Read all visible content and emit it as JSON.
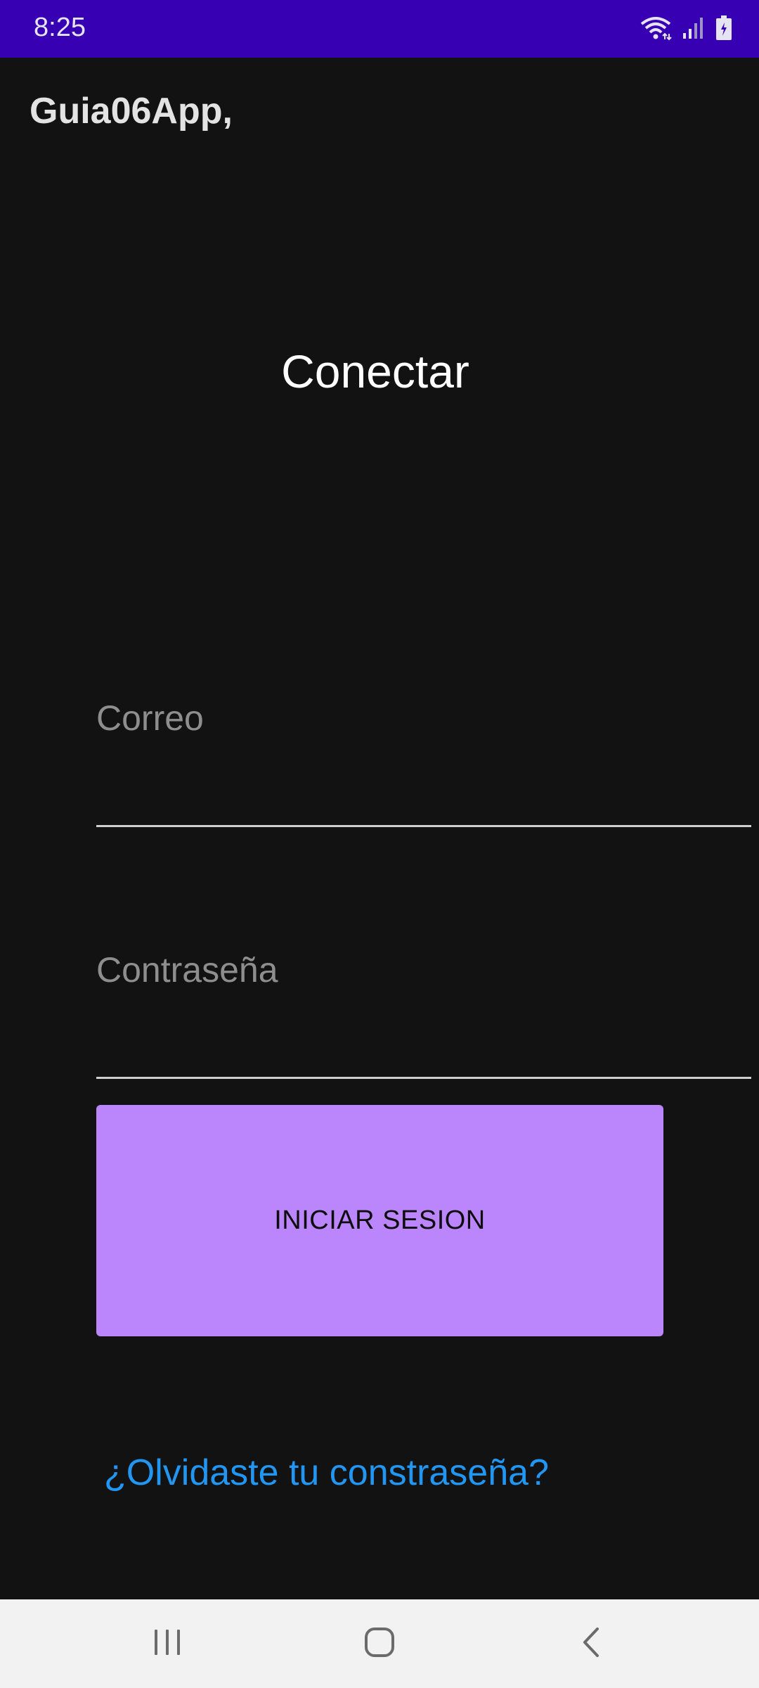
{
  "status_bar": {
    "time": "8:25",
    "icons": [
      "wifi-icon",
      "signal-icon",
      "battery-icon"
    ]
  },
  "app": {
    "title": "Guia06App,"
  },
  "login": {
    "heading": "Conectar",
    "email_placeholder": "Correo",
    "password_placeholder": "Contraseña",
    "button_label": "INICIAR SESION",
    "forgot_link": "¿Olvidaste tu constraseña?"
  },
  "nav_bar": {
    "buttons": [
      "recent-apps-icon",
      "home-icon",
      "back-icon"
    ]
  },
  "colors": {
    "status_bar": "#3700B3",
    "background": "#121212",
    "button": "#BB86FC",
    "link": "#2196F3"
  }
}
